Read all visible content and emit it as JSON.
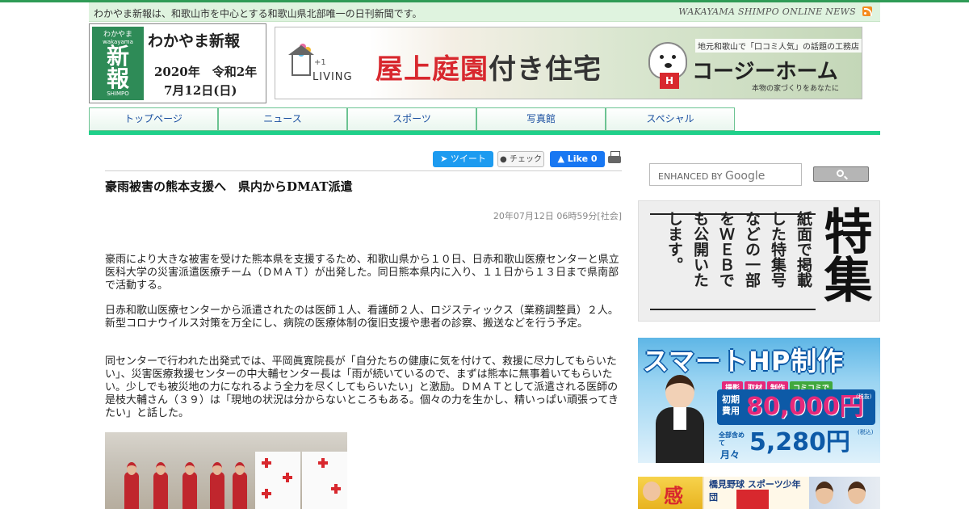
{
  "header": {
    "tagline": "わかやま新報は、和歌山市を中心とする和歌山県北部唯一の日刊新聞です。",
    "english_name": "WAKAYAMA SHIMPO ONLINE NEWS",
    "rss_icon": "rss-icon"
  },
  "logo": {
    "small_top": "わかやま",
    "small_mid": "wakayama",
    "big_1": "新",
    "big_2": "報",
    "small_bottom": "SHIMPO",
    "name": "わかやま新報",
    "year": "2020年　令和2年",
    "date": "7月12日(日)"
  },
  "banner": {
    "plus": "+1",
    "brand": "LIVING",
    "headline_red": "屋上庭園",
    "headline_dark": "付き住宅",
    "subtitle": "地元和歌山で「口コミ人気」の話題の工務店",
    "mark": "H",
    "company": "コージーホーム",
    "tagline": "本物の家づくりをあなたに"
  },
  "nav": {
    "items": [
      {
        "label": "トップページ"
      },
      {
        "label": "ニュース"
      },
      {
        "label": "スポーツ"
      },
      {
        "label": "写真館"
      },
      {
        "label": "スペシャル"
      }
    ]
  },
  "share": {
    "tweet": "ツイート",
    "check": "チェック",
    "like": "Like 0",
    "print_icon": "print-icon"
  },
  "article": {
    "title": "豪雨被害の熊本支援へ　県内からDMAT派遣",
    "meta": "20年07月12日 06時59分[社会]",
    "paragraphs": [
      "豪雨により大きな被害を受けた熊本県を支援するため、和歌山県から１０日、日赤和歌山医療センターと県立医科大学の災害派遣医療チーム（ＤＭＡＴ）が出発した。同日熊本県内に入り、１１日から１３日まで県南部で活動する。",
      "日赤和歌山医療センターから派遣されたのは医師１人、看護師２人、ロジスティックス（業務調整員）２人。新型コロナウイルス対策を万全にし、病院の医療体制の復旧支援や患者の診察、搬送などを行う予定。",
      "同センターで行われた出発式では、平岡眞寛院長が「自分たちの健康に気を付けて、救援に尽力してもらいたい」、災害医療救援センターの中大輔センター長は「雨が続いているので、まずは熊本に無事着いてもらいたい。少しでも被災地の力になれるよう全力を尽くしてもらいたい」と激励。ＤＭＡＴとして派遣される医師の是枝大輔さん（３９）は「現地の状況は分からないところもある。個々の力を生かし、精いっぱい頑張ってきたい」と話した。"
    ]
  },
  "sidebar": {
    "search": {
      "placeholder_prefix": "ENHANCED BY",
      "placeholder_brand": "Google",
      "button_icon": "search-icon"
    },
    "tokushu": {
      "columns": [
        "紙面で掲載",
        "した特集号",
        "などの一部",
        "をＷＥＢで",
        "も公開いた",
        "します。"
      ],
      "big": "特集"
    },
    "smart_hp": {
      "title": "スマートHP制作",
      "tags": [
        "撮影",
        "取材",
        "制作",
        "コミコミで"
      ],
      "label_initial": "初期費用",
      "price_initial": "80,000円",
      "tax_note_1": "(税抜)",
      "label_all": "全部含めて",
      "label_monthly": "月々",
      "price_monthly": "5,280円",
      "tax_note_2": "(税込)"
    },
    "thumbs": {
      "left_text": "感",
      "middle_text": "橋見野球 スポーツ少年団"
    }
  }
}
